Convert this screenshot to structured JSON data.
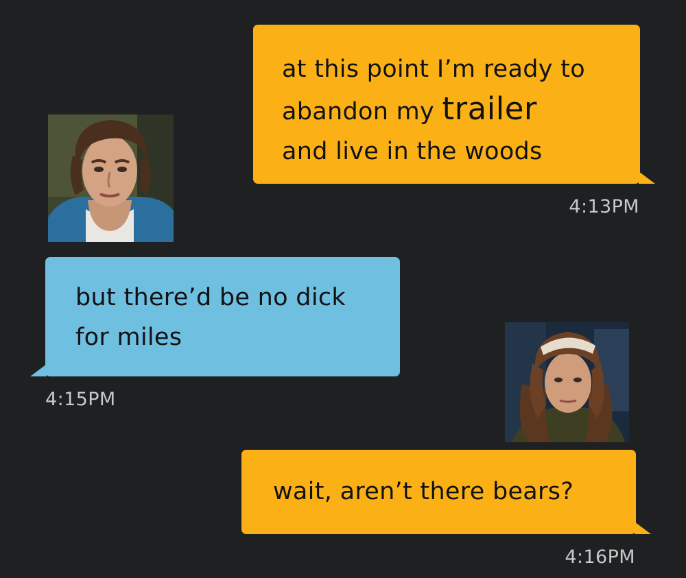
{
  "conversation": {
    "messages": [
      {
        "direction": "outgoing",
        "lines": {
          "line1": "at this point I’m ready to",
          "line2_prefix": "abandon my",
          "line2_emphasis": "trailer",
          "line3": "and live in the woods"
        },
        "time": "4:13PM"
      },
      {
        "direction": "incoming",
        "lines": {
          "line1": "but there’d be no dick",
          "line2": "for miles"
        },
        "time": "4:15PM"
      },
      {
        "direction": "outgoing",
        "lines": {
          "line1": "wait, aren’t there bears?"
        },
        "time": "4:16PM"
      }
    ]
  },
  "colors": {
    "background": "#1f2022",
    "outgoing_bubble": "#fbb116",
    "incoming_bubble": "#6fbfe1",
    "timestamp": "#c9c9c9",
    "text": "#111214"
  },
  "avatars": {
    "left": "profile-photo-brown-haired-man",
    "right": "profile-photo-curly-haired-man-with-bandana"
  }
}
